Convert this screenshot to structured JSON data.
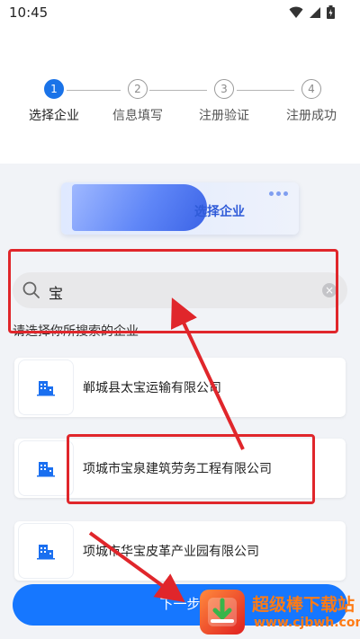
{
  "status_bar": {
    "time": "10:45"
  },
  "steps": [
    {
      "number": "1",
      "label": "选择企业",
      "active": true
    },
    {
      "number": "2",
      "label": "信息填写",
      "active": false
    },
    {
      "number": "3",
      "label": "注册验证",
      "active": false
    },
    {
      "number": "4",
      "label": "注册成功",
      "active": false
    }
  ],
  "banner": {
    "title": "选择企业"
  },
  "search": {
    "value": "宝"
  },
  "hint": "请选择你所搜索的企业",
  "companies": [
    {
      "name": "郸城县太宝运输有限公司"
    },
    {
      "name": "项城市宝泉建筑劳务工程有限公司"
    },
    {
      "name": "项城市华宝皮革产业园有限公司"
    }
  ],
  "next_button": {
    "label": "下一步"
  },
  "watermark": {
    "title": "超级棒下载站",
    "url": "www.cjbwh.com"
  },
  "colors": {
    "primary": "#1677ff",
    "annotation": "#e0262b",
    "background": "#f1f3f7"
  },
  "icons": [
    "wifi-icon",
    "signal-icon",
    "battery-icon",
    "search-icon",
    "clear-icon",
    "building-icon"
  ]
}
